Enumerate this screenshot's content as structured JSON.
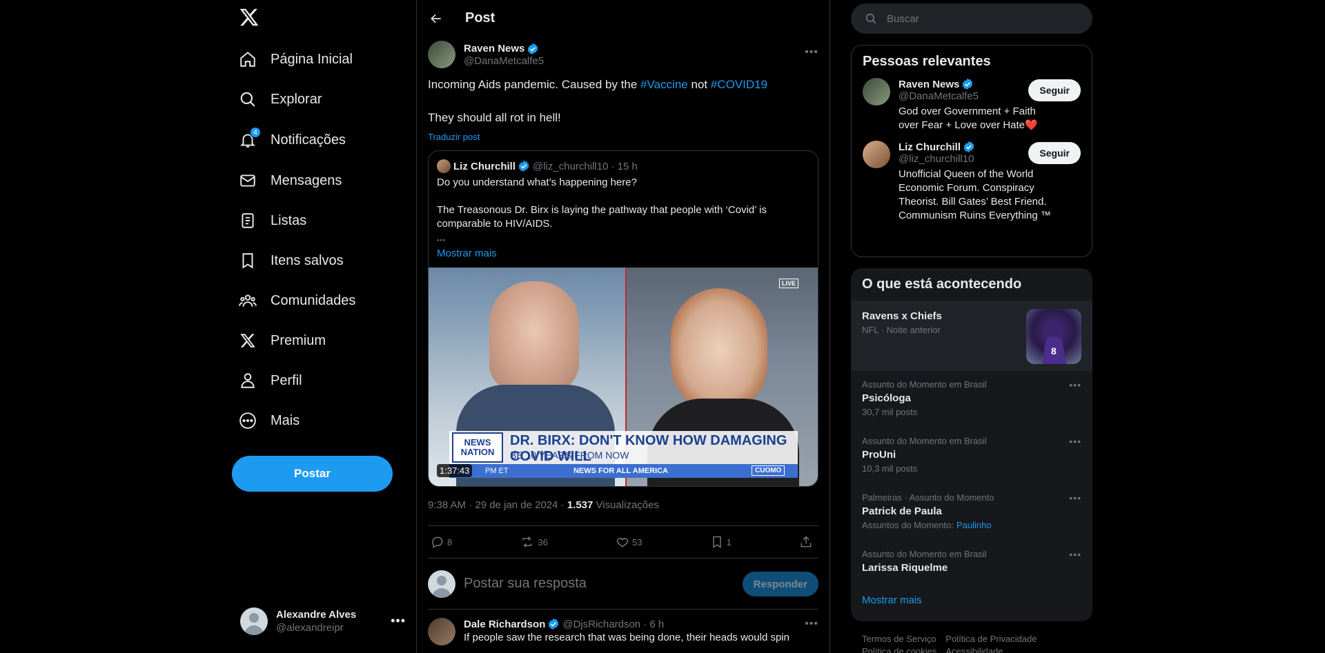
{
  "nav": {
    "items": [
      {
        "label": "Página Inicial"
      },
      {
        "label": "Explorar"
      },
      {
        "label": "Notificações",
        "badge": "4"
      },
      {
        "label": "Mensagens"
      },
      {
        "label": "Listas"
      },
      {
        "label": "Itens salvos"
      },
      {
        "label": "Comunidades"
      },
      {
        "label": "Premium"
      },
      {
        "label": "Perfil"
      },
      {
        "label": "Mais"
      }
    ],
    "post_button": "Postar",
    "account": {
      "name": "Alexandre Alves",
      "handle": "@alexandreipr"
    }
  },
  "header": {
    "title": "Post"
  },
  "tweet": {
    "name": "Raven News",
    "handle": "@DanaMetcalfe5",
    "text_part1": "Incoming Aids pandemic. Caused by the ",
    "tag1": "#Vaccine",
    "text_part2": " not ",
    "tag2": "#COVID19",
    "text_line2": "They should all rot in hell!",
    "translate": "Traduzir post",
    "quote": {
      "name": "Liz Churchill",
      "handle": "@liz_churchill10",
      "time": "· 15 h",
      "line1": "Do you understand what’s happening here?",
      "line2": "The Treasonous Dr. Birx is laying the pathway that people with ‘Covid’ is comparable to HIV/AIDS.",
      "line3": "...",
      "show_more": "Mostrar mais",
      "video": {
        "duration": "1:37:43",
        "live": "LIVE",
        "logo_line1": "NEWS",
        "logo_line2": "NATION",
        "headline1": "DR. BIRX: DON'T KNOW HOW DAMAGING COVID WILL",
        "headline2": "BE 10 YEARS FROM NOW",
        "ticker": "NEWS FOR ALL AMERICA",
        "show": "CUOMO",
        "time_tag": "PM ET"
      }
    },
    "meta_time": "9:38 AM · 29 de jan de 2024 · ",
    "views_count": "1.537",
    "views_label": " Visualizações",
    "actions": {
      "replies": "8",
      "reposts": "36",
      "likes": "53",
      "bookmarks": "1"
    }
  },
  "reply": {
    "placeholder": "Postar sua resposta",
    "button": "Responder"
  },
  "next_tweet": {
    "name": "Dale Richardson",
    "handle": "@DjsRichardson",
    "time": "· 6 h",
    "text": "If people saw the research that was being done, their heads would spin"
  },
  "search": {
    "placeholder": "Buscar"
  },
  "relevant": {
    "title": "Pessoas relevantes",
    "people": [
      {
        "name": "Raven News",
        "handle": "@DanaMetcalfe5",
        "bio": "God over Government + Faith over Fear + Love over Hate❤️",
        "button": "Seguir"
      },
      {
        "name": "Liz Churchill",
        "handle": "@liz_churchill10",
        "bio": "Unofficial Queen of the World Economic Forum. Conspiracy Theorist. Bill Gates’ Best Friend. Communism Ruins Everything ™",
        "button": "Seguir"
      }
    ]
  },
  "trends": {
    "title": "O que está acontecendo",
    "featured": {
      "title": "Ravens x Chiefs",
      "context": "NFL · Noite anterior"
    },
    "items": [
      {
        "context": "Assunto do Momento em Brasil",
        "title": "Psicóloga",
        "count": "30,7 mil posts"
      },
      {
        "context": "Assunto do Momento em Brasil",
        "title": "ProUni",
        "count": "10,3 mil posts"
      },
      {
        "context": "Palmeiras · Assunto do Momento",
        "title": "Patrick de Paula",
        "count": "Assuntos do Momento:",
        "link": "Paulinho"
      },
      {
        "context": "Assunto do Momento em Brasil",
        "title": "Larissa Riquelme",
        "count": ""
      }
    ],
    "show_more": "Mostrar mais"
  },
  "footer": {
    "links": [
      "Termos de Serviço",
      "Política de Privacidade",
      "Política de cookies",
      "Acessibilidade"
    ]
  },
  "colors": {
    "accent": "#1d9bf0",
    "background": "#000000",
    "border": "#2f3336",
    "muted": "#71767b"
  }
}
